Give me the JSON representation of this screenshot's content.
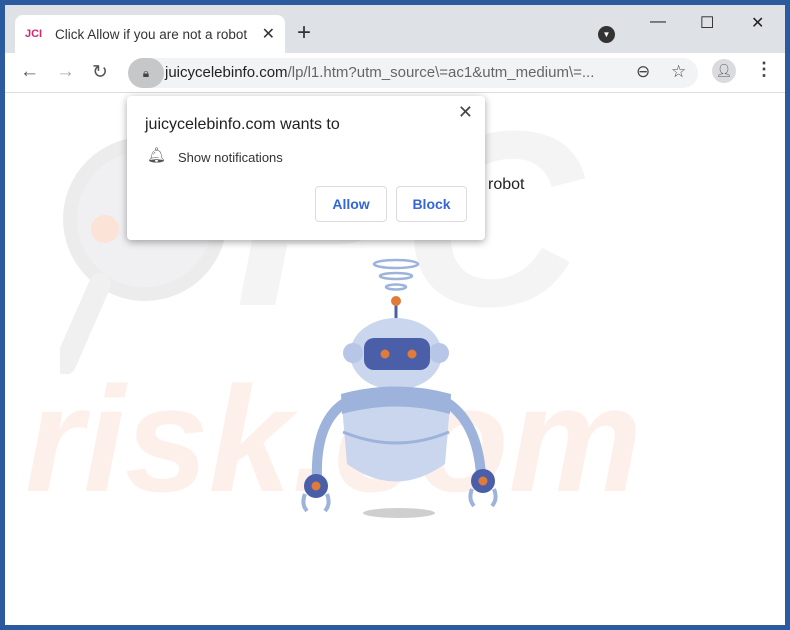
{
  "tab": {
    "favicon": "JCI",
    "title": "Click Allow if you are not a robot",
    "close": "✕",
    "new_tab": "+"
  },
  "window": {
    "minimize": "—",
    "maximize": "☐",
    "close": "✕"
  },
  "toolbar": {
    "back": "←",
    "forward": "→",
    "reload": "↻",
    "url_domain": "juicycelebinfo.com",
    "url_path": "/lp/l1.htm?utm_source\\=ac1&utm_medium\\=...",
    "zoom": "⊖",
    "bookmark": "☆",
    "menu": "⋮"
  },
  "popup": {
    "title": "juicycelebinfo.com wants to",
    "permission": "Show notifications",
    "allow": "Allow",
    "block": "Block",
    "close": "✕"
  },
  "page": {
    "heading": "robot"
  },
  "watermark": {
    "top": "PC",
    "bottom": "risk.com"
  },
  "colors": {
    "frame": "#2b5b9e",
    "button_text": "#3367d6",
    "robot_body": "#c9d6ee",
    "robot_accent": "#4a5fa8",
    "robot_eye": "#e07b3c"
  }
}
